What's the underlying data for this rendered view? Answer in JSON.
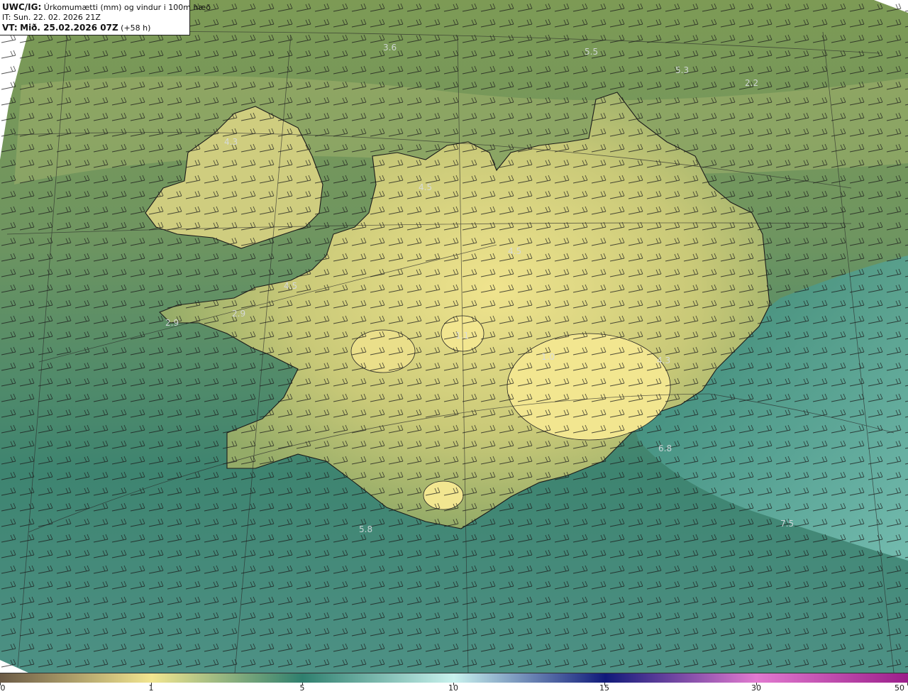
{
  "header": {
    "model": "UWC/IG:",
    "title": "Úrkomumætti (mm) og vindur i 100m hæð",
    "it_label": "IT:",
    "it_value": "Sun. 22. 02. 2026 21Z",
    "vt_label": "VT:",
    "vt_value": "Mið. 25.02.2026 07Z",
    "vt_lead": "(+58 h)"
  },
  "map_values": [
    "3.6",
    "5.5",
    "5.3",
    "2.2",
    "4.3",
    "4.5",
    "4.5",
    "4.5",
    "2.9",
    "2.9",
    "1.1",
    "1.0",
    "4.3",
    "6.8",
    "5.8",
    "7.5"
  ],
  "colorbar": {
    "ticks": [
      "0",
      "1",
      "5",
      "10",
      "15",
      "30",
      "50"
    ],
    "colors": {
      "c0": "#6b5a45",
      "c1": "#f2e690",
      "c5": "#2f7f6e",
      "c10": "#c8f2ee",
      "c15": "#101a7a",
      "c30": "#e27ad0",
      "c50": "#9b1e8a"
    }
  }
}
